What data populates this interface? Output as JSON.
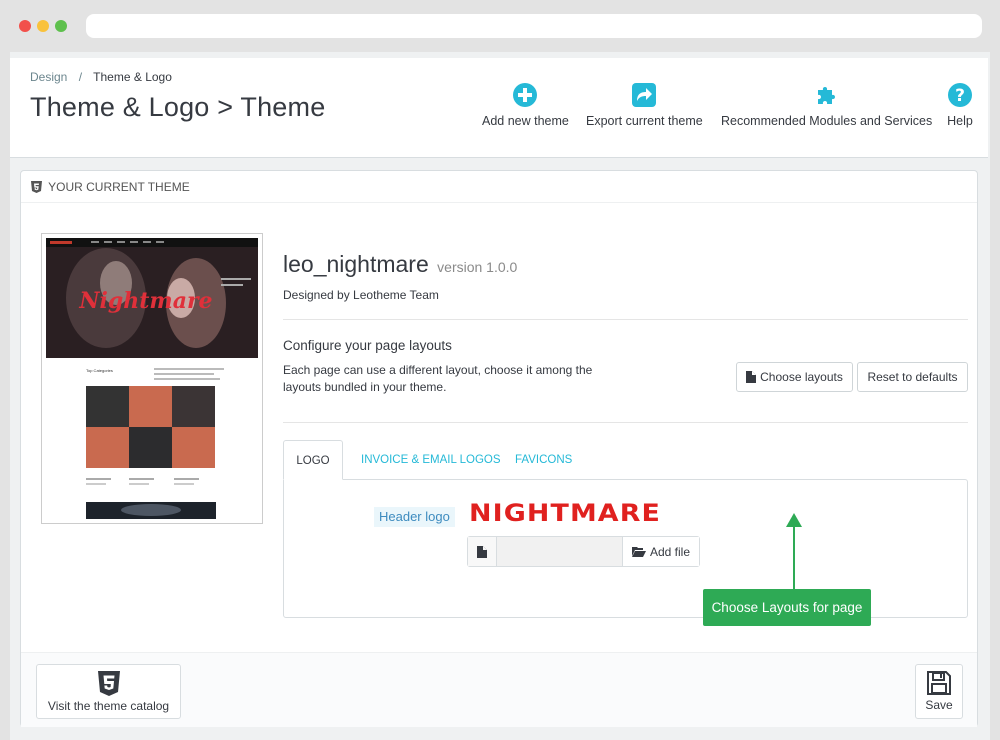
{
  "colors": {
    "accent": "#25b9d7",
    "tooltip": "#2eaa55",
    "logo_red": "#e0211f"
  },
  "breadcrumb": {
    "parent": "Design",
    "separator": "/",
    "current": "Theme & Logo"
  },
  "page_title": "Theme & Logo > Theme",
  "toolbar": {
    "add_new_theme": "Add new theme",
    "export_current_theme": "Export current theme",
    "recommended_modules": "Recommended Modules and Services",
    "help": "Help"
  },
  "panel": {
    "heading": "YOUR CURRENT THEME",
    "theme_name": "leo_nightmare",
    "theme_version": "version 1.0.0",
    "designed_by": "Designed by Leotheme Team",
    "configure_title": "Configure your page layouts",
    "configure_desc": "Each page can use a different layout, choose it among the layouts bundled in your theme.",
    "choose_layouts": "Choose layouts",
    "reset_defaults": "Reset to defaults"
  },
  "thumbnail": {
    "hero_text": "Nightmare",
    "section_title": "Top Categories"
  },
  "tabs": [
    {
      "label": "LOGO",
      "active": true
    },
    {
      "label": "INVOICE & EMAIL LOGOS",
      "active": false
    },
    {
      "label": "FAVICONS",
      "active": false
    }
  ],
  "logo_tab": {
    "header_logo_label": "Header logo",
    "logo_text": "NIGHTMARE",
    "add_file": "Add file",
    "file_value": ""
  },
  "annotation": {
    "tooltip": "Choose Layouts for page"
  },
  "footer": {
    "visit_catalog": "Visit the theme catalog",
    "save": "Save"
  }
}
